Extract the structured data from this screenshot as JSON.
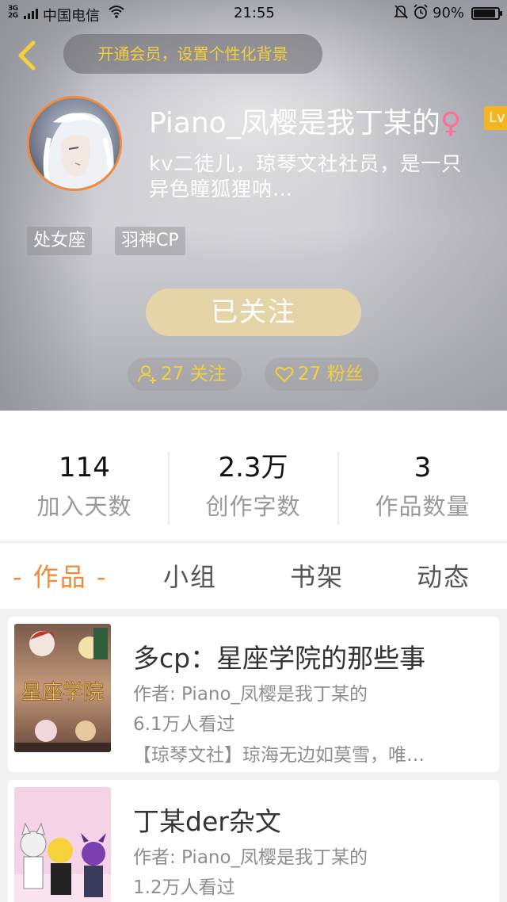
{
  "status_bar": {
    "signal": "3G\n2G",
    "carrier": "中国电信",
    "time": "21:55",
    "battery": "90%",
    "battery_level": 0.9,
    "icons": [
      "wifi-icon",
      "mute-icon",
      "alarm-icon",
      "battery-icon"
    ]
  },
  "header": {
    "vip_banner": "开通会员，设置个性化背景",
    "username": "Piano_凤樱是我丁某的",
    "gender_symbol": "♀",
    "level_badge": "Lv",
    "bio_line1": "kv二徒儿，琼琴文社社员，是一只",
    "bio_line2": "异色瞳狐狸呐…",
    "tags": [
      "处女座",
      "羽神CP"
    ],
    "follow_button": "已关注",
    "following": "27 关注",
    "fans": "27 粉丝"
  },
  "stats": [
    {
      "value": "114",
      "label": "加入天数"
    },
    {
      "value": "2.3万",
      "label": "创作字数"
    },
    {
      "value": "3",
      "label": "作品数量"
    }
  ],
  "tabs": {
    "works": "- 作品 -",
    "groups": "小组",
    "bookshelf": "书架",
    "activity": "动态"
  },
  "works": [
    {
      "title": "多cp：星座学院的那些事",
      "author": "作者: Piano_凤樱是我丁某的",
      "views": "6.1万人看过",
      "desc": "【琼琴文社】琼海无边如莫雪，唯…",
      "cover_text": "星座学院"
    },
    {
      "title": "丁某der杂文",
      "author": "作者: Piano_凤樱是我丁某的",
      "views": "1.2万人看过"
    }
  ],
  "colors": {
    "accent_orange": "#f08a3c",
    "gold_text": "#f5cf3c",
    "follow_button_bg": "#e5d4a8",
    "level_badge_bg": "#f6b51e"
  }
}
